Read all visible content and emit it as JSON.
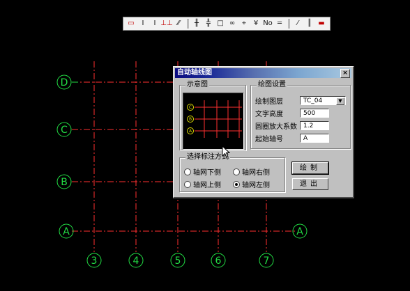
{
  "canvas": {
    "axis_labels": {
      "row_top": "D",
      "row_mid": "C",
      "row_low": "B",
      "row_bottom_left": "A",
      "row_bottom_right": "A",
      "col_1": "3",
      "col_2": "4",
      "col_3": "5",
      "col_4": "6",
      "col_5": "7"
    },
    "colors": {
      "axis_line": "#ff3030",
      "bubble": "#22dd44",
      "background": "#000000"
    }
  },
  "toolbar": {
    "buttons": [
      "▭",
      "I",
      "I",
      "⊥⊥",
      "⁄⁄",
      "╫",
      "╬",
      "□",
      "∞",
      "⌖",
      "¥",
      "No",
      "═",
      "⁄",
      "║",
      "▬"
    ]
  },
  "dialog": {
    "title": "自动轴线图",
    "close_label": "×",
    "preview_group": {
      "label": "示意图",
      "axis_labels": [
        "C",
        "B",
        "A"
      ]
    },
    "settings_group": {
      "label": "绘图设置",
      "fields": [
        {
          "label": "绘制图层",
          "value": "TC_04",
          "type": "select"
        },
        {
          "label": "文字高度",
          "value": "500",
          "type": "input"
        },
        {
          "label": "圆圈放大系数",
          "value": "1.2",
          "type": "input"
        },
        {
          "label": "起始轴号",
          "value": "A",
          "type": "input"
        }
      ]
    },
    "annotation_group": {
      "label": "选择标注方式",
      "options": [
        {
          "label": "轴网下侧",
          "selected": false
        },
        {
          "label": "轴网右侧",
          "selected": false
        },
        {
          "label": "轴网上侧",
          "selected": false
        },
        {
          "label": "轴网左侧",
          "selected": true
        }
      ]
    },
    "draw_button": "绘制",
    "exit_button": "退出"
  }
}
